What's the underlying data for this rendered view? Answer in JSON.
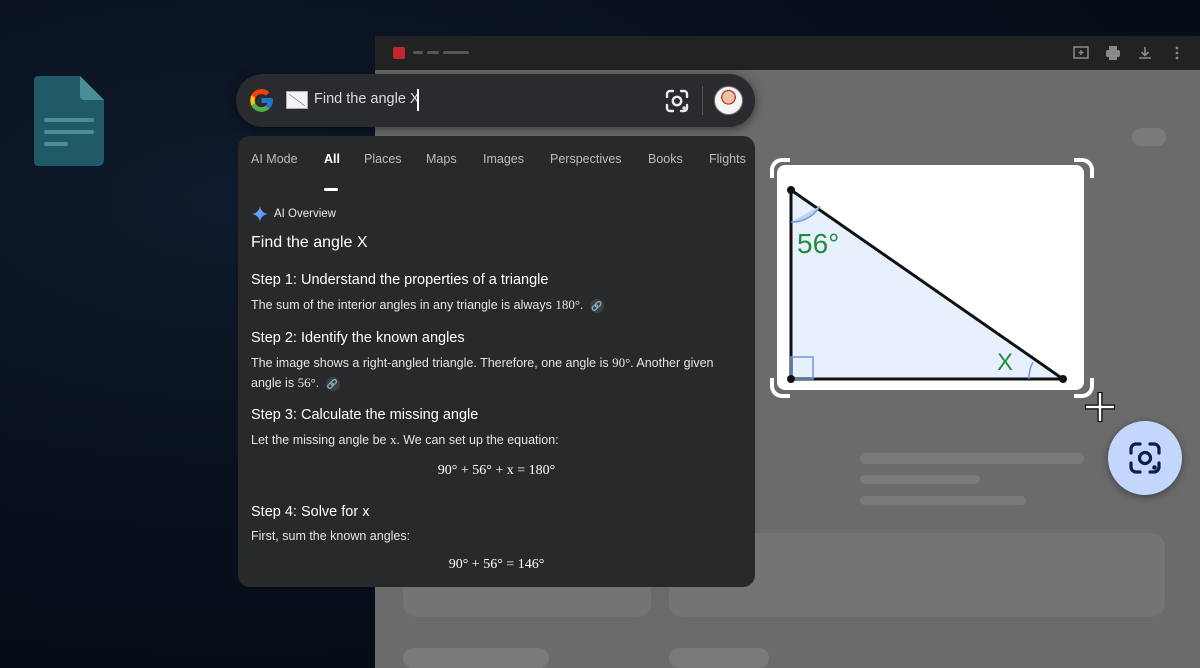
{
  "colors": {
    "accent_blue": "#8ab4f8",
    "angle_label_green": "#1e8e3e",
    "panel_bg": "#28292b",
    "lens_fab_bg": "#c2d7fb"
  },
  "desktop": {
    "app_icon": "google-docs-icon"
  },
  "background_window": {
    "toolbar_icons": [
      "add-comment-icon",
      "print-icon",
      "download-icon",
      "more-vert-icon"
    ]
  },
  "search": {
    "query": "Find the angle X",
    "icons": [
      "google-logo-icon",
      "image-thumbnail-icon",
      "lens-icon",
      "avatar"
    ]
  },
  "tabs": [
    {
      "label": "AI Mode"
    },
    {
      "label": "All",
      "active": true
    },
    {
      "label": "Places"
    },
    {
      "label": "Maps"
    },
    {
      "label": "Images"
    },
    {
      "label": "Perspectives"
    },
    {
      "label": "Books"
    },
    {
      "label": "Flights"
    }
  ],
  "overview": {
    "label": "AI Overview",
    "query": "Find the angle X",
    "steps": [
      {
        "title": "Step 1: Understand the properties of a triangle",
        "body_text": "The sum of the interior angles in any triangle is always",
        "body_value": "180°."
      },
      {
        "title": "Step 2: Identify the known angles",
        "body_a": "The image shows a right-angled triangle. Therefore, one angle is",
        "body_v1": "90°.",
        "body_b": "Another given angle is",
        "body_v2": "56°."
      },
      {
        "title": "Step 3: Calculate the missing angle",
        "body_text": "Let the missing angle be",
        "body_var": "x.",
        "body_tail": "We can set up the equation:",
        "equation": "90° + 56° + x = 180°"
      },
      {
        "title": "Step 4: Solve for x",
        "body_text": "First, sum the known angles:",
        "equation": "90° + 56° = 146°"
      }
    ]
  },
  "selection": {
    "angle_label": "56°",
    "unknown_label": "X"
  }
}
